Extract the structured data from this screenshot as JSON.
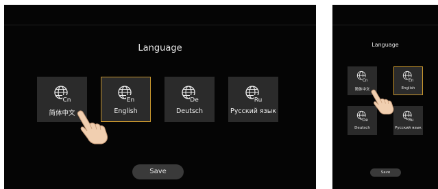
{
  "large": {
    "title": "Language",
    "options": [
      {
        "code": "Cn",
        "label": "简体中文",
        "selected": false
      },
      {
        "code": "En",
        "label": "English",
        "selected": true
      },
      {
        "code": "De",
        "label": "Deutsch",
        "selected": false
      },
      {
        "code": "Ru",
        "label": "Русский язык",
        "selected": false
      }
    ],
    "save_label": "Save"
  },
  "small": {
    "title": "Language",
    "options": [
      {
        "code": "Cn",
        "label": "简体中文",
        "selected": false
      },
      {
        "code": "En",
        "label": "English",
        "selected": true
      },
      {
        "code": "De",
        "label": "Deutsch",
        "selected": false
      },
      {
        "code": "Ru",
        "label": "Русский язык",
        "selected": false
      }
    ],
    "save_label": "Save"
  },
  "icons": {
    "language": "globe-icon",
    "pointer": "hand-pointer-icon"
  },
  "colors": {
    "background": "#050505",
    "tile": "#2b2b2b",
    "selected_border": "#c8962e",
    "save_button": "#3a3a3a",
    "text": "#f0f0f0"
  }
}
